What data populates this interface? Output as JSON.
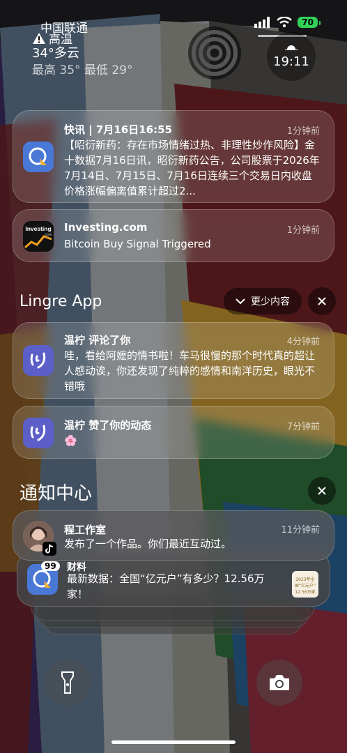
{
  "status_bar": {
    "carrier": "中国联通",
    "alert": "高温",
    "temperature": "34°多云",
    "high_low": "最高 35° 最低 29°",
    "battery": "70",
    "clock": "19:11"
  },
  "notifications": [
    {
      "app": "news",
      "title": "快讯 | 7月16日16:55",
      "time": "1分钟前",
      "body": "【昭衍新药：存在市场情绪过热、非理性炒作风险】金十数据7月16日讯，昭衍新药公告，公司股票于2026年7月14日、7月15日、7月16日连续三个交易日内收盘价格涨幅偏离值累计超过2..."
    },
    {
      "app": "investing",
      "icon_text": "Investing",
      "icon_subtext": ".com",
      "title": "Investing.com",
      "time": "1分钟前",
      "body": "Bitcoin Buy Signal Triggered"
    }
  ],
  "group": {
    "title": "Lingre App",
    "show_less": "更少内容",
    "items": [
      {
        "title": "温柠 评论了你",
        "time": "4分钟前",
        "body": "哇，看给阿嬷的情书啦！车马很慢的那个时代真的超让人感动诶，你还发现了纯粹的感情和南洋历史，眼光不错哦"
      },
      {
        "title": "温柠 赞了你的动态",
        "time": "7分钟前",
        "body": "🌸"
      }
    ]
  },
  "notification_center": {
    "title": "通知中心",
    "top": {
      "title": "程工作室",
      "time": "11分钟前",
      "body": "发布了一个作品。你们最近互动过。"
    },
    "second": {
      "badge": "99",
      "title": "财料",
      "body": "最新数据：全国“亿元户”有多少？12.56万家！",
      "thumb_line1": "2023年全国“亿元户”",
      "thumb_line2": "12.56万家"
    }
  },
  "icons": {
    "flashlight": "flashlight-icon",
    "camera": "camera-icon"
  }
}
